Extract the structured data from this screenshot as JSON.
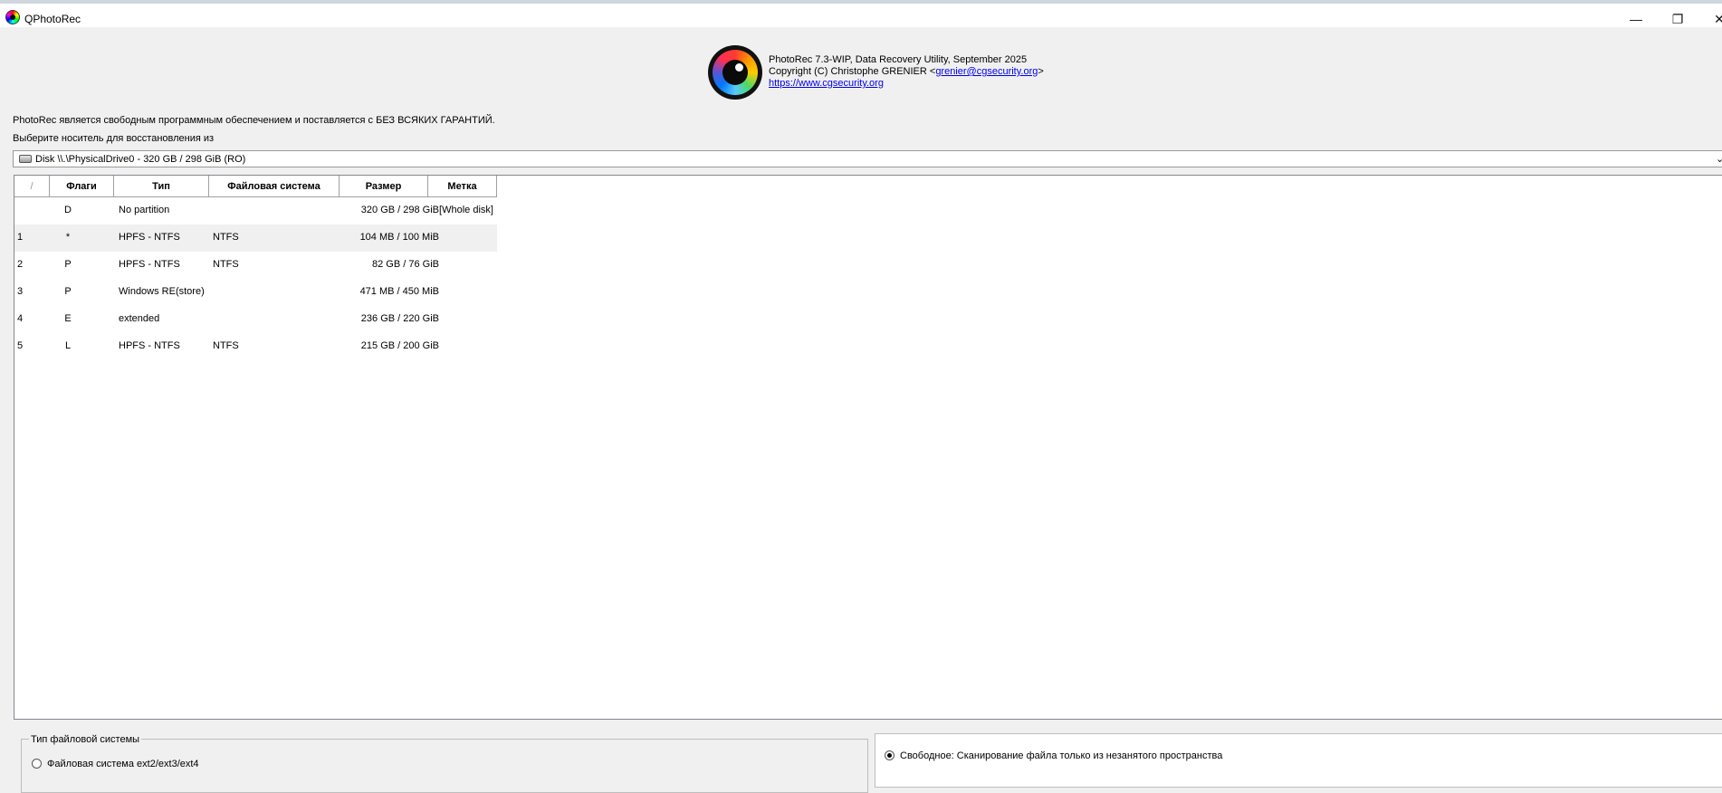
{
  "window": {
    "title": "QPhotoRec",
    "minimize": "—",
    "maximize": "❐",
    "close": "✕"
  },
  "header": {
    "line1": "PhotoRec 7.3-WIP, Data Recovery Utility, September 2025",
    "line2_prefix": "Copyright (C) Christophe GRENIER <",
    "email": "grenier@cgsecurity.org",
    "line2_suffix": ">",
    "website": "https://www.cgsecurity.org"
  },
  "licence_text": "PhotoRec является свободным программным обеспечением и поставляется с БЕЗ ВСЯКИХ ГАРАНТИЙ.",
  "choose_label": "Выберите носитель для восстановления из",
  "disk_select": {
    "value": "Disk \\\\.\\PhysicalDrive0 - 320 GB / 298 GiB (RO)",
    "icon": "hard-disk-icon"
  },
  "table": {
    "headers": [
      "/",
      "Флаги",
      "Тип",
      "Файловая система",
      "Размер",
      "Метка"
    ],
    "rows": [
      {
        "num": "",
        "flag": "D",
        "type": "No partition",
        "fs": "",
        "size": "320 GB / 298 GiB",
        "label": "[Whole disk]"
      },
      {
        "num": "1",
        "flag": "*",
        "type": "HPFS - NTFS",
        "fs": "NTFS",
        "size": "104 MB / 100 MiB",
        "label": ""
      },
      {
        "num": "2",
        "flag": "P",
        "type": "HPFS - NTFS",
        "fs": "NTFS",
        "size": "82 GB / 76 GiB",
        "label": ""
      },
      {
        "num": "3",
        "flag": "P",
        "type": "Windows RE(store)",
        "fs": "",
        "size": "471 MB / 450 MiB",
        "label": ""
      },
      {
        "num": "4",
        "flag": "E",
        "type": "extended",
        "fs": "",
        "size": "236 GB / 220 GiB",
        "label": ""
      },
      {
        "num": "5",
        "flag": "L",
        "type": "HPFS - NTFS",
        "fs": "NTFS",
        "size": "215 GB / 200 GiB",
        "label": ""
      }
    ]
  },
  "fs_type": {
    "title": "Тип файловой системы",
    "option_ext": "Файловая система ext2/ext3/ext4"
  },
  "scan_mode": {
    "option_free": "Свободное: Сканирование файла только из незанятого пространства"
  }
}
